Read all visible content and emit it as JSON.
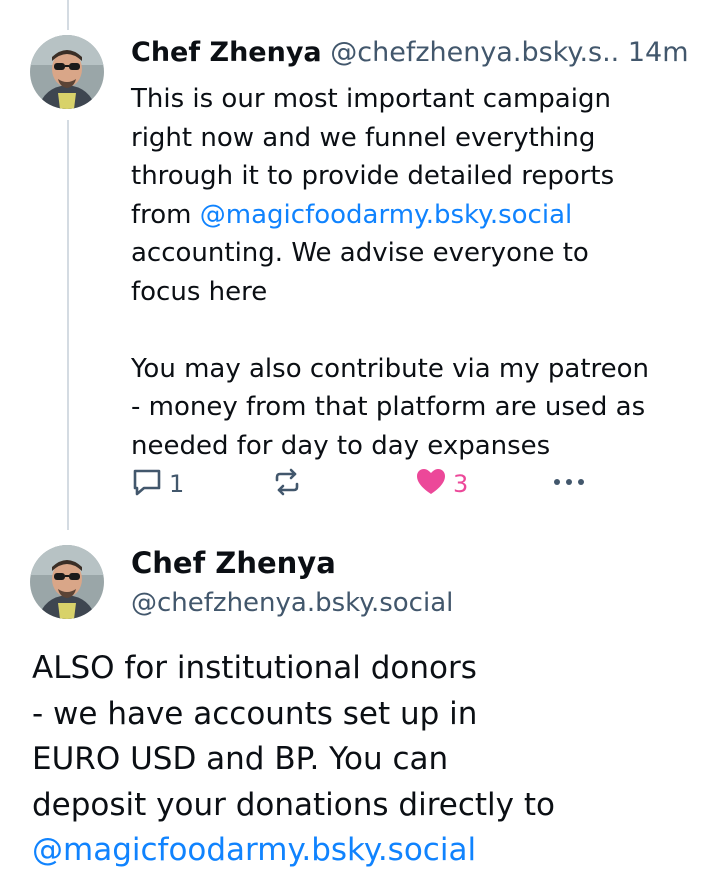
{
  "post1": {
    "author_name": "Chef Zhenya",
    "author_handle": "@chefzhenya.bsky.s..",
    "time": "14m",
    "text_lines": [
      "This is our most important campaign",
      "right now and we funnel everything",
      "through it to provide detailed reports"
    ],
    "text_from": "from ",
    "mention": "@magicfoodarmy.bsky.social",
    "text_after_lines": [
      "accounting. We advise everyone to",
      "focus here"
    ],
    "text_p2_lines": [
      "You may also contribute via my patreon",
      "- money from that platform are used as",
      "needed for day to day expanses"
    ],
    "reply_count": "1",
    "like_count": "3",
    "icons": {
      "reply": "reply-bubble-icon",
      "repost": "repost-icon",
      "like": "heart-icon",
      "more": "more-dots-icon"
    }
  },
  "post2": {
    "author_name": "Chef Zhenya",
    "author_handle": "@chefzhenya.bsky.social",
    "text_lines": [
      "ALSO for institutional donors",
      "- we have accounts set up in",
      "EURO USD and BP. You can",
      "deposit your donations directly to"
    ],
    "mention": "@magicfoodarmy.bsky.social"
  },
  "colors": {
    "link": "#1083fe",
    "muted": "#42576c",
    "like": "#ec4899",
    "thread_line": "#d4dbe2"
  }
}
